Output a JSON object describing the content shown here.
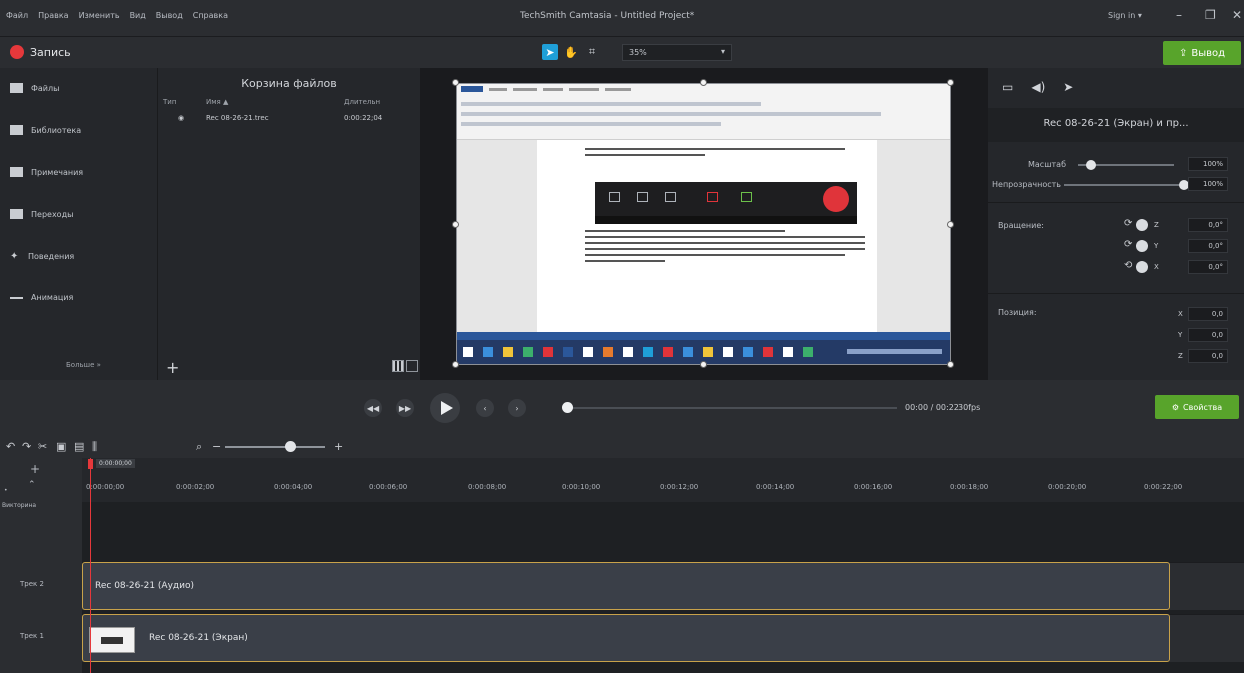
{
  "menubar": {
    "items": [
      "Файл",
      "Правка",
      "Изменить",
      "Вид",
      "Вывод",
      "Справка"
    ],
    "title": "TechSmith Camtasia - Untitled Project*",
    "signin": "Sign in ▾",
    "min": "–",
    "max": "❐",
    "close": "✕"
  },
  "toolbar": {
    "record_label": "Запись",
    "zoom": "35%",
    "export_label": "Вывод"
  },
  "sidebar": {
    "items": [
      {
        "label": "Файлы",
        "icon": "media-icon"
      },
      {
        "label": "Библиотека",
        "icon": "library-icon"
      },
      {
        "label": "Примечания",
        "icon": "annotations-icon"
      },
      {
        "label": "Переходы",
        "icon": "transitions-icon"
      },
      {
        "label": "Поведения",
        "icon": "behaviors-icon"
      },
      {
        "label": "Анимация",
        "icon": "animations-icon"
      }
    ],
    "more": "Больше »"
  },
  "bin": {
    "title": "Корзина файлов",
    "col_type": "Тип",
    "col_name": "Имя ▲",
    "col_duration": "Длительн",
    "row_name": "Rec 08-26-21.trec",
    "row_duration": "0:00:22;04"
  },
  "properties": {
    "clip_title": "Rec 08-26-21 (Экран) и пр...",
    "scale_label": "Масштаб",
    "scale_value": "100%",
    "scale_fraction": 1.0,
    "opacity_label": "Непрозрачность",
    "opacity_value": "100%",
    "opacity_fraction": 1.0,
    "rotation_label": "Вращение:",
    "rot_z": "0,0°",
    "rot_y": "0,0°",
    "rot_x": "0,0°",
    "position_label": "Позиция:",
    "pos_x": "0,0",
    "pos_y": "0,0",
    "pos_z": "0,0"
  },
  "playback": {
    "time": "00:00 / 00:22",
    "fps": "30fps",
    "props_button": "Свойства"
  },
  "timeline": {
    "playhead_time": "0:00:00;00",
    "ticks": [
      "0:00:00;00",
      "0:00:02;00",
      "0:00:04;00",
      "0:00:06;00",
      "0:00:08;00",
      "0:00:10;00",
      "0:00:12;00",
      "0:00:14;00",
      "0:00:16;00",
      "0:00:18;00",
      "0:00:20;00",
      "0:00:22;00"
    ],
    "gutter_markers": "Викторина",
    "track2_label": "Трек 2",
    "track1_label": "Трек 1",
    "clip_audio": "Rec 08-26-21 (Аудио)",
    "clip_screen": "Rec 08-26-21 (Экран)"
  },
  "colors": {
    "accent_green": "#58a42b",
    "record_red": "#e5383b",
    "clip_border": "#c8a24a",
    "select_blue": "#1f9fd8"
  }
}
